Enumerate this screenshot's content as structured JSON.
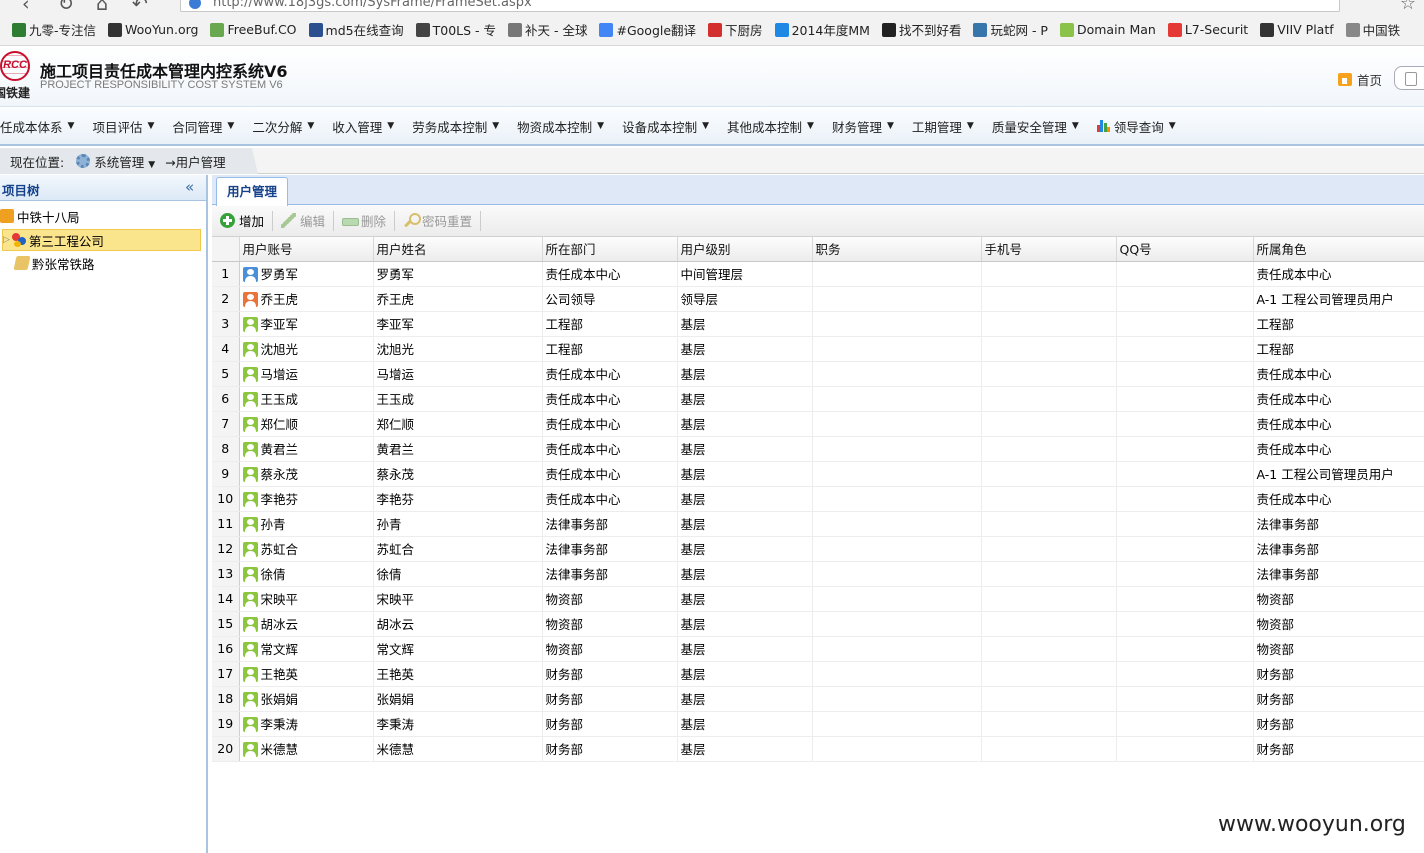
{
  "browser": {
    "url": "http://www.18j3gs.com/SysFrame/FrameSet.aspx",
    "bookmarks": [
      {
        "label": "九零-专注信",
        "icon": "jiuling-icon",
        "color": "#2e7d32"
      },
      {
        "label": "WooYun.org",
        "icon": "wooyun-icon",
        "color": "#333333"
      },
      {
        "label": "FreeBuf.CO",
        "icon": "freebuf-icon",
        "color": "#6aa84f"
      },
      {
        "label": "md5在线查询",
        "icon": "grid-icon",
        "color": "#2b4f8f"
      },
      {
        "label": "T00LS - 专",
        "icon": "tools-icon",
        "color": "#444444"
      },
      {
        "label": "补天 - 全球",
        "icon": "butian-icon",
        "color": "#777777"
      },
      {
        "label": "#Google翻译",
        "icon": "translate-icon",
        "color": "#4285f4"
      },
      {
        "label": "下厨房",
        "icon": "xiachufang-icon",
        "color": "#d32f2f"
      },
      {
        "label": "2014年度MM",
        "icon": "play-icon",
        "color": "#1e88e5"
      },
      {
        "label": "找不到好看",
        "icon": "w-icon",
        "color": "#222222"
      },
      {
        "label": "玩蛇网 - P",
        "icon": "python-icon",
        "color": "#3776ab"
      },
      {
        "label": "Domain Man",
        "icon": "domain-icon",
        "color": "#8bc34a"
      },
      {
        "label": "L7-Securit",
        "icon": "l7-icon",
        "color": "#e53935"
      },
      {
        "label": "VIIV Platf",
        "icon": "code-icon",
        "color": "#333333"
      },
      {
        "label": "中国铁",
        "icon": "page-icon",
        "color": "#888888"
      }
    ]
  },
  "header": {
    "title": "施工项目责任成本管理内控系统V6",
    "subtitle": "PROJECT RESPONSIBILITY COST SYSTEM V6",
    "logo_mark": "RCC",
    "logo_text": "国铁建",
    "home_label": "首页"
  },
  "menu": [
    {
      "label": "任成本体系"
    },
    {
      "label": "项目评估"
    },
    {
      "label": "合同管理"
    },
    {
      "label": "二次分解"
    },
    {
      "label": "收入管理"
    },
    {
      "label": "劳务成本控制"
    },
    {
      "label": "物资成本控制"
    },
    {
      "label": "设备成本控制"
    },
    {
      "label": "其他成本控制"
    },
    {
      "label": "财务管理"
    },
    {
      "label": "工期管理"
    },
    {
      "label": "质量安全管理"
    },
    {
      "label": "领导查询",
      "icon": "bar-chart-icon"
    }
  ],
  "breadcrumb": {
    "prefix": "现在位置:",
    "system": "系统管理",
    "current": "→用户管理"
  },
  "tree": {
    "title": "项目树",
    "nodes": [
      {
        "label": "中铁十八局",
        "icon": "home-icon",
        "selected": false
      },
      {
        "label": "第三工程公司",
        "icon": "group-icon",
        "selected": true
      },
      {
        "label": "黔张常铁路",
        "icon": "road-icon",
        "selected": false
      }
    ]
  },
  "panel": {
    "tab": "用户管理",
    "toolbar": {
      "add": "增加",
      "edit": "编辑",
      "delete": "删除",
      "reset_password": "密码重置"
    },
    "columns": [
      "用户账号",
      "用户姓名",
      "所在部门",
      "用户级别",
      "职务",
      "手机号",
      "QQ号",
      "所属角色"
    ],
    "rows": [
      {
        "n": "1",
        "account": "罗勇军",
        "name": "罗勇军",
        "dept": "责任成本中心",
        "level": "中间管理层",
        "duty": "",
        "phone": "",
        "qq": "",
        "role": "责任成本中心",
        "icon": "blue"
      },
      {
        "n": "2",
        "account": "乔王虎",
        "name": "乔王虎",
        "dept": "公司领导",
        "level": "领导层",
        "duty": "",
        "phone": "",
        "qq": "",
        "role": "A-1 工程公司管理员用户",
        "icon": "orange"
      },
      {
        "n": "3",
        "account": "李亚军",
        "name": "李亚军",
        "dept": "工程部",
        "level": "基层",
        "duty": "",
        "phone": "",
        "qq": "",
        "role": "工程部",
        "icon": "green"
      },
      {
        "n": "4",
        "account": "沈旭光",
        "name": "沈旭光",
        "dept": "工程部",
        "level": "基层",
        "duty": "",
        "phone": "",
        "qq": "",
        "role": "工程部",
        "icon": "green"
      },
      {
        "n": "5",
        "account": "马增运",
        "name": "马增运",
        "dept": "责任成本中心",
        "level": "基层",
        "duty": "",
        "phone": "",
        "qq": "",
        "role": "责任成本中心",
        "icon": "green"
      },
      {
        "n": "6",
        "account": "王玉成",
        "name": "王玉成",
        "dept": "责任成本中心",
        "level": "基层",
        "duty": "",
        "phone": "",
        "qq": "",
        "role": "责任成本中心",
        "icon": "green"
      },
      {
        "n": "7",
        "account": "郑仁顺",
        "name": "郑仁顺",
        "dept": "责任成本中心",
        "level": "基层",
        "duty": "",
        "phone": "",
        "qq": "",
        "role": "责任成本中心",
        "icon": "green"
      },
      {
        "n": "8",
        "account": "黄君兰",
        "name": "黄君兰",
        "dept": "责任成本中心",
        "level": "基层",
        "duty": "",
        "phone": "",
        "qq": "",
        "role": "责任成本中心",
        "icon": "green"
      },
      {
        "n": "9",
        "account": "蔡永茂",
        "name": "蔡永茂",
        "dept": "责任成本中心",
        "level": "基层",
        "duty": "",
        "phone": "",
        "qq": "",
        "role": "A-1 工程公司管理员用户",
        "icon": "green"
      },
      {
        "n": "10",
        "account": "李艳芬",
        "name": "李艳芬",
        "dept": "责任成本中心",
        "level": "基层",
        "duty": "",
        "phone": "",
        "qq": "",
        "role": "责任成本中心",
        "icon": "green"
      },
      {
        "n": "11",
        "account": "孙青",
        "name": "孙青",
        "dept": "法律事务部",
        "level": "基层",
        "duty": "",
        "phone": "",
        "qq": "",
        "role": "法律事务部",
        "icon": "green"
      },
      {
        "n": "12",
        "account": "苏虹合",
        "name": "苏虹合",
        "dept": "法律事务部",
        "level": "基层",
        "duty": "",
        "phone": "",
        "qq": "",
        "role": "法律事务部",
        "icon": "green"
      },
      {
        "n": "13",
        "account": "徐倩",
        "name": "徐倩",
        "dept": "法律事务部",
        "level": "基层",
        "duty": "",
        "phone": "",
        "qq": "",
        "role": "法律事务部",
        "icon": "green"
      },
      {
        "n": "14",
        "account": "宋映平",
        "name": "宋映平",
        "dept": "物资部",
        "level": "基层",
        "duty": "",
        "phone": "",
        "qq": "",
        "role": "物资部",
        "icon": "green"
      },
      {
        "n": "15",
        "account": "胡冰云",
        "name": "胡冰云",
        "dept": "物资部",
        "level": "基层",
        "duty": "",
        "phone": "",
        "qq": "",
        "role": "物资部",
        "icon": "green"
      },
      {
        "n": "16",
        "account": "常文辉",
        "name": "常文辉",
        "dept": "物资部",
        "level": "基层",
        "duty": "",
        "phone": "",
        "qq": "",
        "role": "物资部",
        "icon": "green"
      },
      {
        "n": "17",
        "account": "王艳英",
        "name": "王艳英",
        "dept": "财务部",
        "level": "基层",
        "duty": "",
        "phone": "",
        "qq": "",
        "role": "财务部",
        "icon": "green"
      },
      {
        "n": "18",
        "account": "张娟娟",
        "name": "张娟娟",
        "dept": "财务部",
        "level": "基层",
        "duty": "",
        "phone": "",
        "qq": "",
        "role": "财务部",
        "icon": "green"
      },
      {
        "n": "19",
        "account": "李秉涛",
        "name": "李秉涛",
        "dept": "财务部",
        "level": "基层",
        "duty": "",
        "phone": "",
        "qq": "",
        "role": "财务部",
        "icon": "green"
      },
      {
        "n": "20",
        "account": "米德慧",
        "name": "米德慧",
        "dept": "财务部",
        "level": "基层",
        "duty": "",
        "phone": "",
        "qq": "",
        "role": "财务部",
        "icon": "green"
      }
    ]
  },
  "colors": {
    "user_blue": "#4a90d9",
    "user_orange": "#e8743b",
    "user_green": "#8cc63f",
    "accent": "#15428b"
  },
  "watermark": "www.wooyun.org"
}
